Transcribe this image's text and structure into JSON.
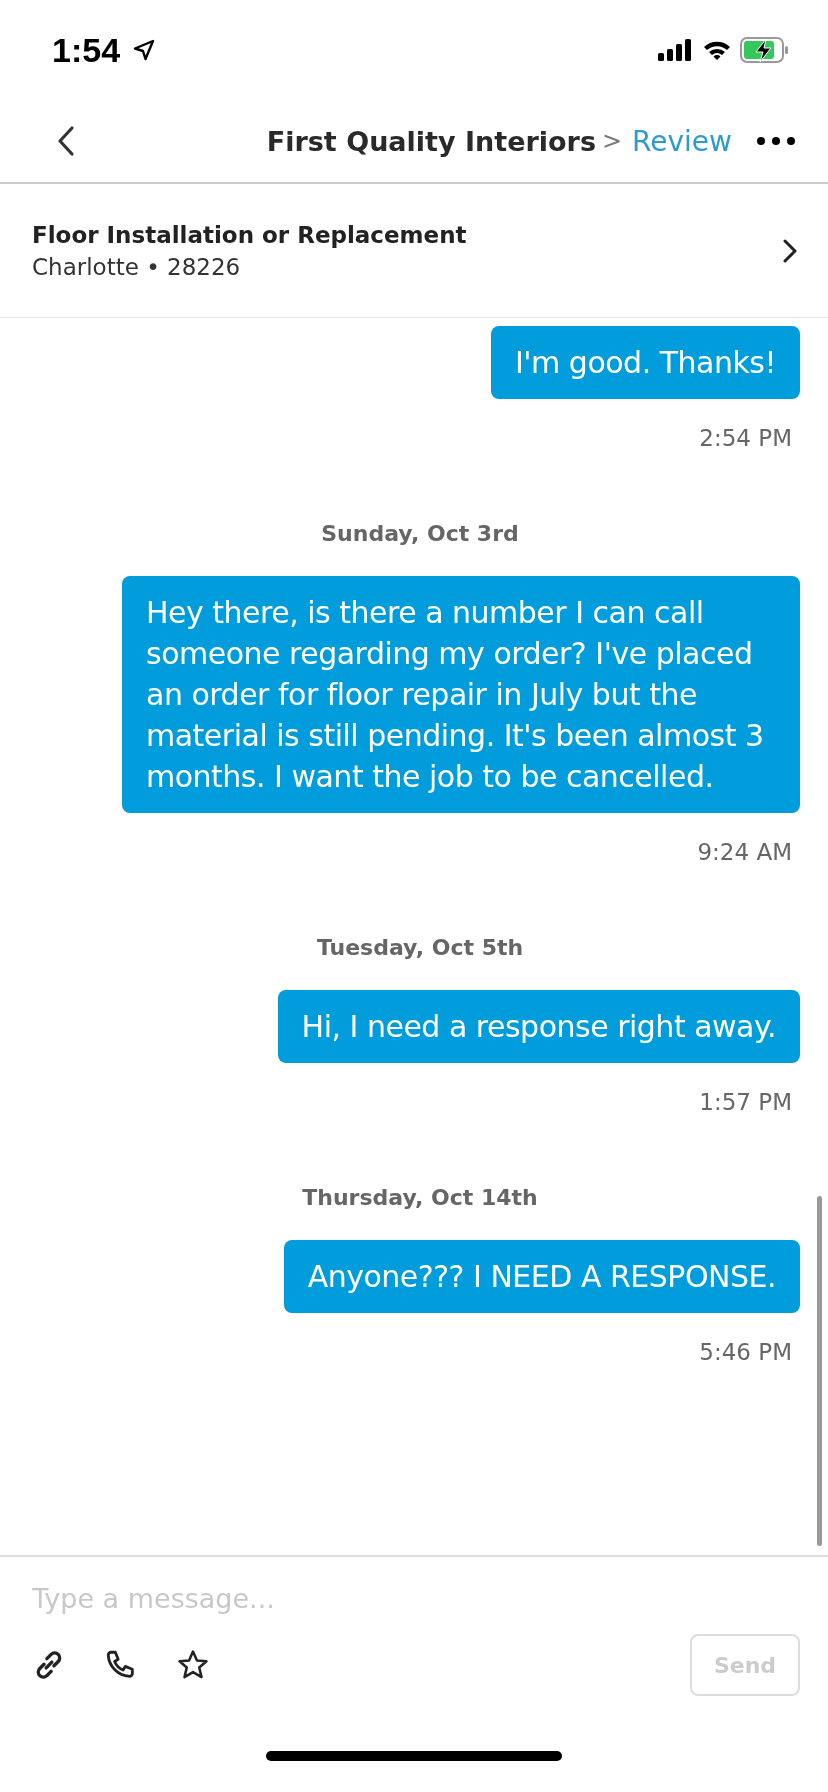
{
  "status_bar": {
    "time": "1:54"
  },
  "nav": {
    "title": "First Quality Interiors",
    "separator": ">",
    "link": "Review"
  },
  "job": {
    "title": "Floor Installation or Replacement",
    "location": "Charlotte • 28226"
  },
  "thread": [
    {
      "kind": "outgoing",
      "text": "I'm good. Thanks!"
    },
    {
      "kind": "time",
      "text": "2:54 PM"
    },
    {
      "kind": "date",
      "text": "Sunday, Oct 3rd"
    },
    {
      "kind": "outgoing",
      "text": "Hey there, is there a number I can call someone regarding my order? I've placed an order for floor repair in July but the material is still pending. It's been almost 3 months. I want the job to be cancelled."
    },
    {
      "kind": "time",
      "text": "9:24 AM"
    },
    {
      "kind": "date",
      "text": "Tuesday, Oct 5th"
    },
    {
      "kind": "outgoing",
      "text": "Hi, I need a response right away."
    },
    {
      "kind": "time",
      "text": "1:57 PM"
    },
    {
      "kind": "date",
      "text": "Thursday, Oct 14th"
    },
    {
      "kind": "outgoing",
      "text": "Anyone??? I NEED A RESPONSE."
    },
    {
      "kind": "time",
      "text": "5:46 PM"
    }
  ],
  "composer": {
    "placeholder": "Type a message...",
    "send": "Send",
    "send_disabled": true
  }
}
